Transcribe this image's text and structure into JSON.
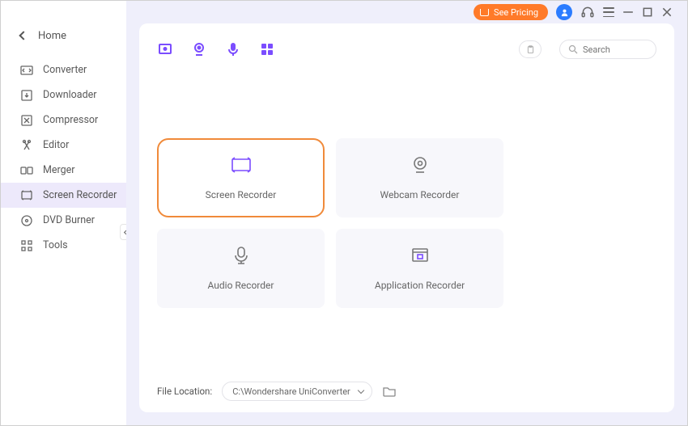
{
  "sidebar": {
    "home": "Home",
    "items": [
      {
        "label": "Converter"
      },
      {
        "label": "Downloader"
      },
      {
        "label": "Compressor"
      },
      {
        "label": "Editor"
      },
      {
        "label": "Merger"
      },
      {
        "label": "Screen Recorder"
      },
      {
        "label": "DVD Burner"
      },
      {
        "label": "Tools"
      }
    ]
  },
  "titlebar": {
    "pricing": "See Pricing"
  },
  "search": {
    "placeholder": "Search"
  },
  "cards": [
    {
      "label": "Screen Recorder"
    },
    {
      "label": "Webcam Recorder"
    },
    {
      "label": "Audio Recorder"
    },
    {
      "label": "Application Recorder"
    }
  ],
  "footer": {
    "label": "File Location:",
    "path": "C:\\Wondershare UniConverter"
  }
}
